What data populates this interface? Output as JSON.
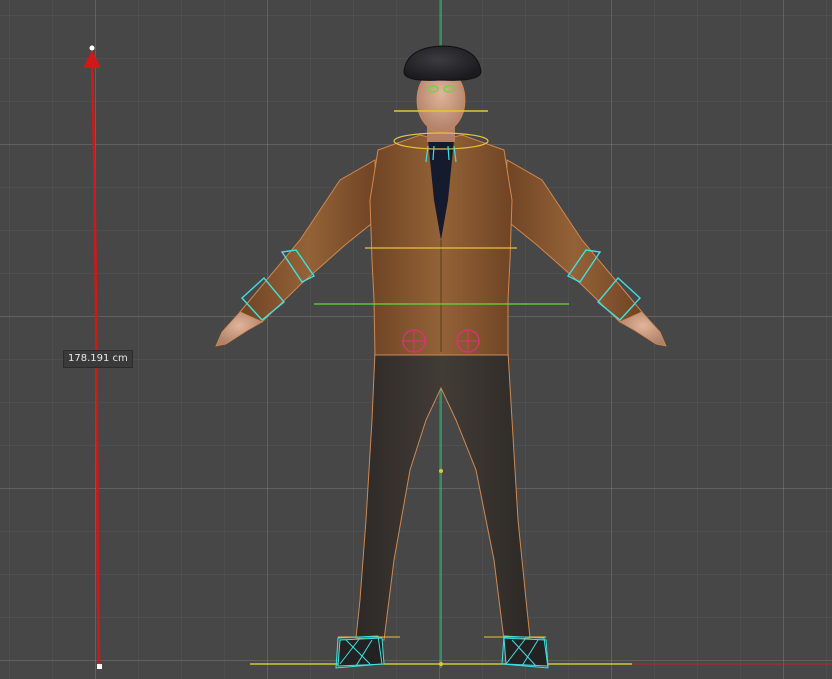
{
  "viewport": {
    "height_measure_text": "178.191 cm"
  },
  "colors": {
    "background": "#474747",
    "measure_line": "#d11818",
    "ground_line": "#e6e632",
    "vertical_axis": "#38c878",
    "jacket": "#8a5a30",
    "pants": "#38332e",
    "bone_cyan": "#3fe0e0",
    "bone_yellow": "#e8c23a",
    "bone_green": "#5fdc3a",
    "target_magenta": "#e0307a"
  },
  "icons": {
    "measure_arrow": "arrow-up-icon",
    "target_left": "crosshair-circle-icon",
    "target_right": "crosshair-circle-icon"
  }
}
